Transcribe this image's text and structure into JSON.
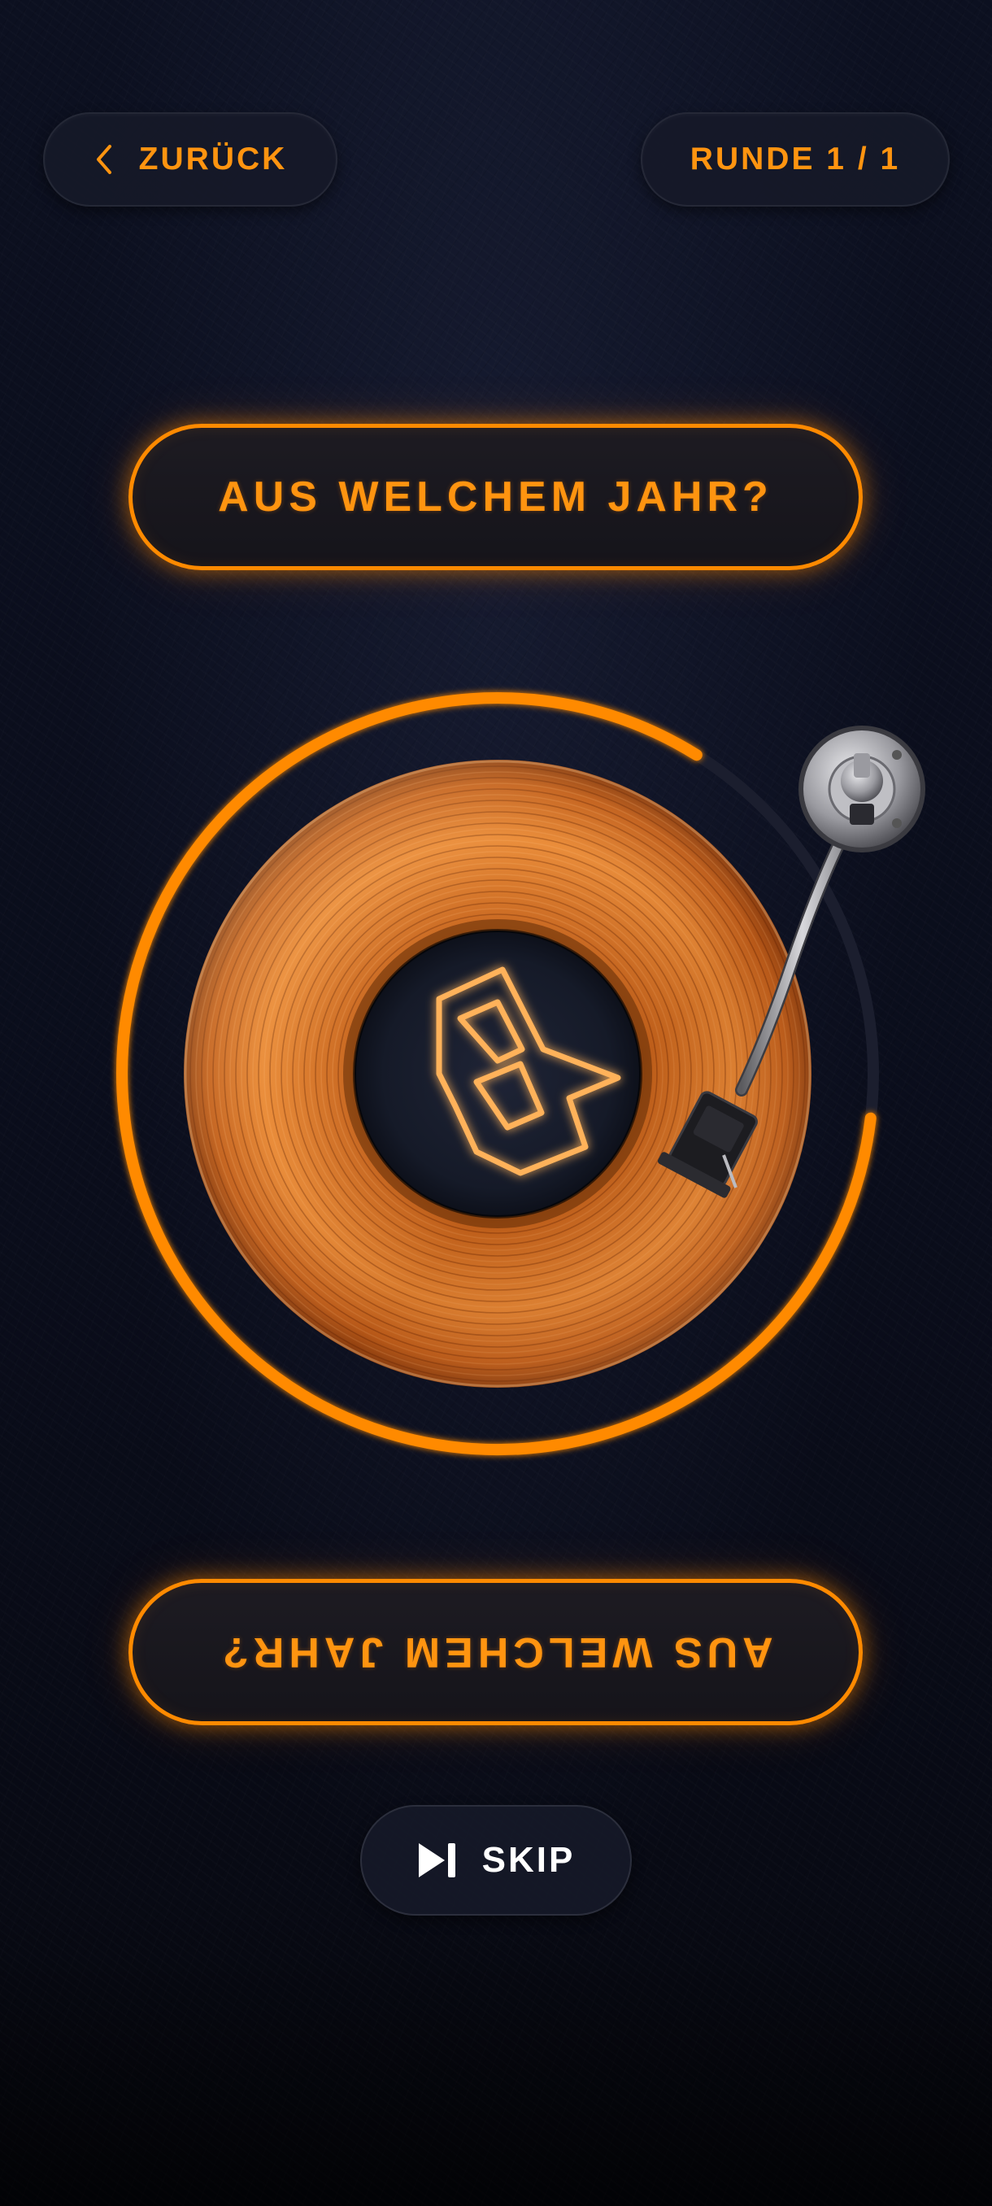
{
  "header": {
    "back_label": "ZURÜCK",
    "round_label": "RUNDE 1 / 1"
  },
  "question": {
    "top_text": "AUS WELCHEM JAHR?",
    "bottom_text": "AUS WELCHEM JAHR?"
  },
  "player": {
    "progress_fraction": 0.82
  },
  "skip": {
    "label": "SKIP"
  },
  "icons": {
    "back": "chevron-left-icon",
    "skip": "skip-next-icon",
    "logo": "hitster-logo-icon"
  },
  "colors": {
    "accent": "#ff8a00",
    "accent_text": "#ff9410",
    "background": "#0b0f1e",
    "pill_bg": "#161928",
    "skip_text": "#ffffff"
  }
}
